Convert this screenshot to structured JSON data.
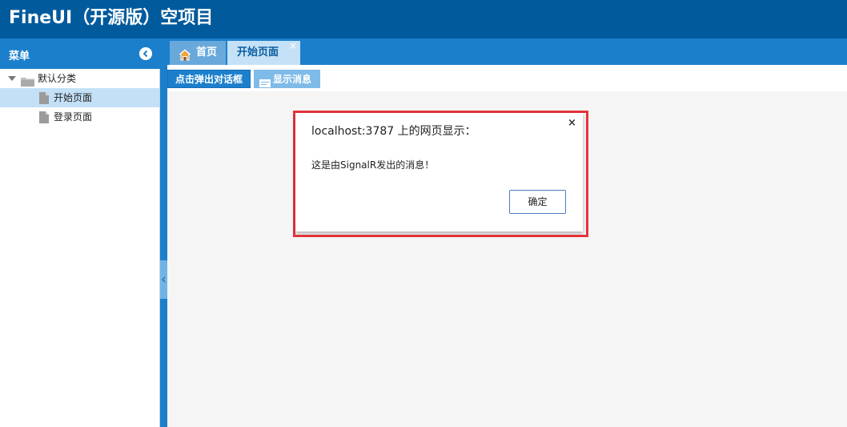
{
  "app": {
    "title": "FineUI（开源版）空项目"
  },
  "sidebar": {
    "title": "菜单",
    "tree": {
      "root": {
        "label": "默认分类",
        "icon": "folder-icon",
        "expanded": true
      },
      "items": [
        {
          "label": "开始页面",
          "icon": "page-icon",
          "selected": true
        },
        {
          "label": "登录页面",
          "icon": "page-icon",
          "selected": false
        }
      ]
    }
  },
  "tabs": [
    {
      "label": "首页",
      "icon": "home-icon",
      "active": false
    },
    {
      "label": "开始页面",
      "active": true,
      "closable": true,
      "close_glyph": "×"
    }
  ],
  "toolbar": {
    "dialog_button": "点击弹出对话框",
    "message_button": "显示消息"
  },
  "dialog": {
    "title": "localhost:3787 上的网页显示：",
    "message": "这是由SignalR发出的消息！",
    "ok_label": "确定",
    "close_glyph": "×"
  },
  "colors": {
    "header_bg": "#005a9c",
    "accent": "#1b7fcc",
    "selected_row": "#c3e0f7",
    "highlight_border": "#e5353b"
  }
}
